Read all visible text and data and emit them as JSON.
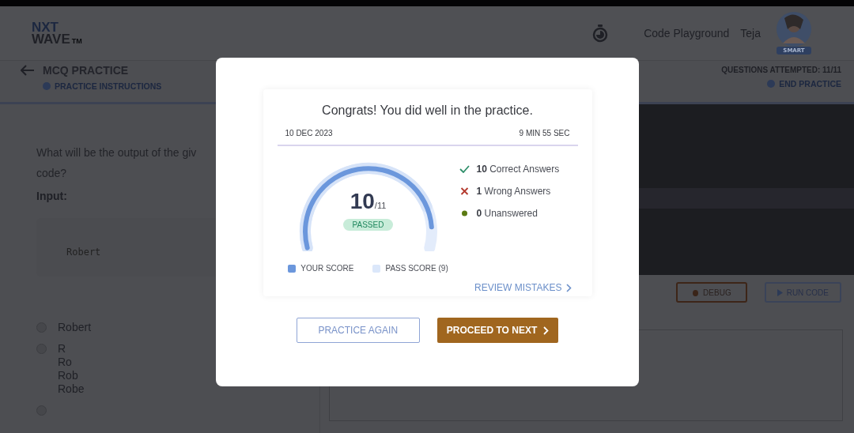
{
  "header": {
    "logo": {
      "line_1": "NXT",
      "line_2": "WAVE",
      "mark": "TM"
    },
    "nav": [
      "Code Playground",
      "Teja"
    ],
    "avatar": {
      "badge": "SMART"
    }
  },
  "subheader": {
    "title": "MCQ PRACTICE",
    "instructions": "PRACTICE INSTRUCTIONS",
    "attempted": "QUESTIONS ATTEMPTED: 11/11",
    "end": "END PRACTICE"
  },
  "question": {
    "text": "What will be the output of the giv",
    "text_2": "code?",
    "input_label": "Input:",
    "input_value": "Robert",
    "options": [
      {
        "label": "Robert",
        "selected": false
      },
      {
        "label": "R\nRo\nRob\nRobe",
        "selected": false
      },
      {
        "selected": false
      }
    ]
  },
  "editor": {
    "buttons": [
      {
        "kind": "debug",
        "label": "DEBUG"
      },
      {
        "kind": "run",
        "label": "RUN CODE"
      }
    ]
  },
  "modal": {
    "title": "Congrats! You did well in the practice.",
    "date": "10 DEC 2023",
    "duration": "9 MIN 55 SEC",
    "score": {
      "value": "10",
      "total": "/11",
      "status": "PASSED"
    },
    "legend": [
      "YOUR SCORE",
      "PASS SCORE (9)"
    ],
    "stats": [
      {
        "kind": "correct",
        "count": "10",
        "label": "Correct Answers"
      },
      {
        "kind": "wrong",
        "count": "1",
        "label": "Wrong Answers"
      },
      {
        "kind": "unanswered",
        "count": "0",
        "label": "Unanswered"
      }
    ],
    "review": "REVIEW MISTAKES",
    "buttons": [
      {
        "kind": "secondary",
        "label": "PRACTICE AGAIN"
      },
      {
        "kind": "primary",
        "label": "PROCEED TO NEXT"
      }
    ]
  }
}
